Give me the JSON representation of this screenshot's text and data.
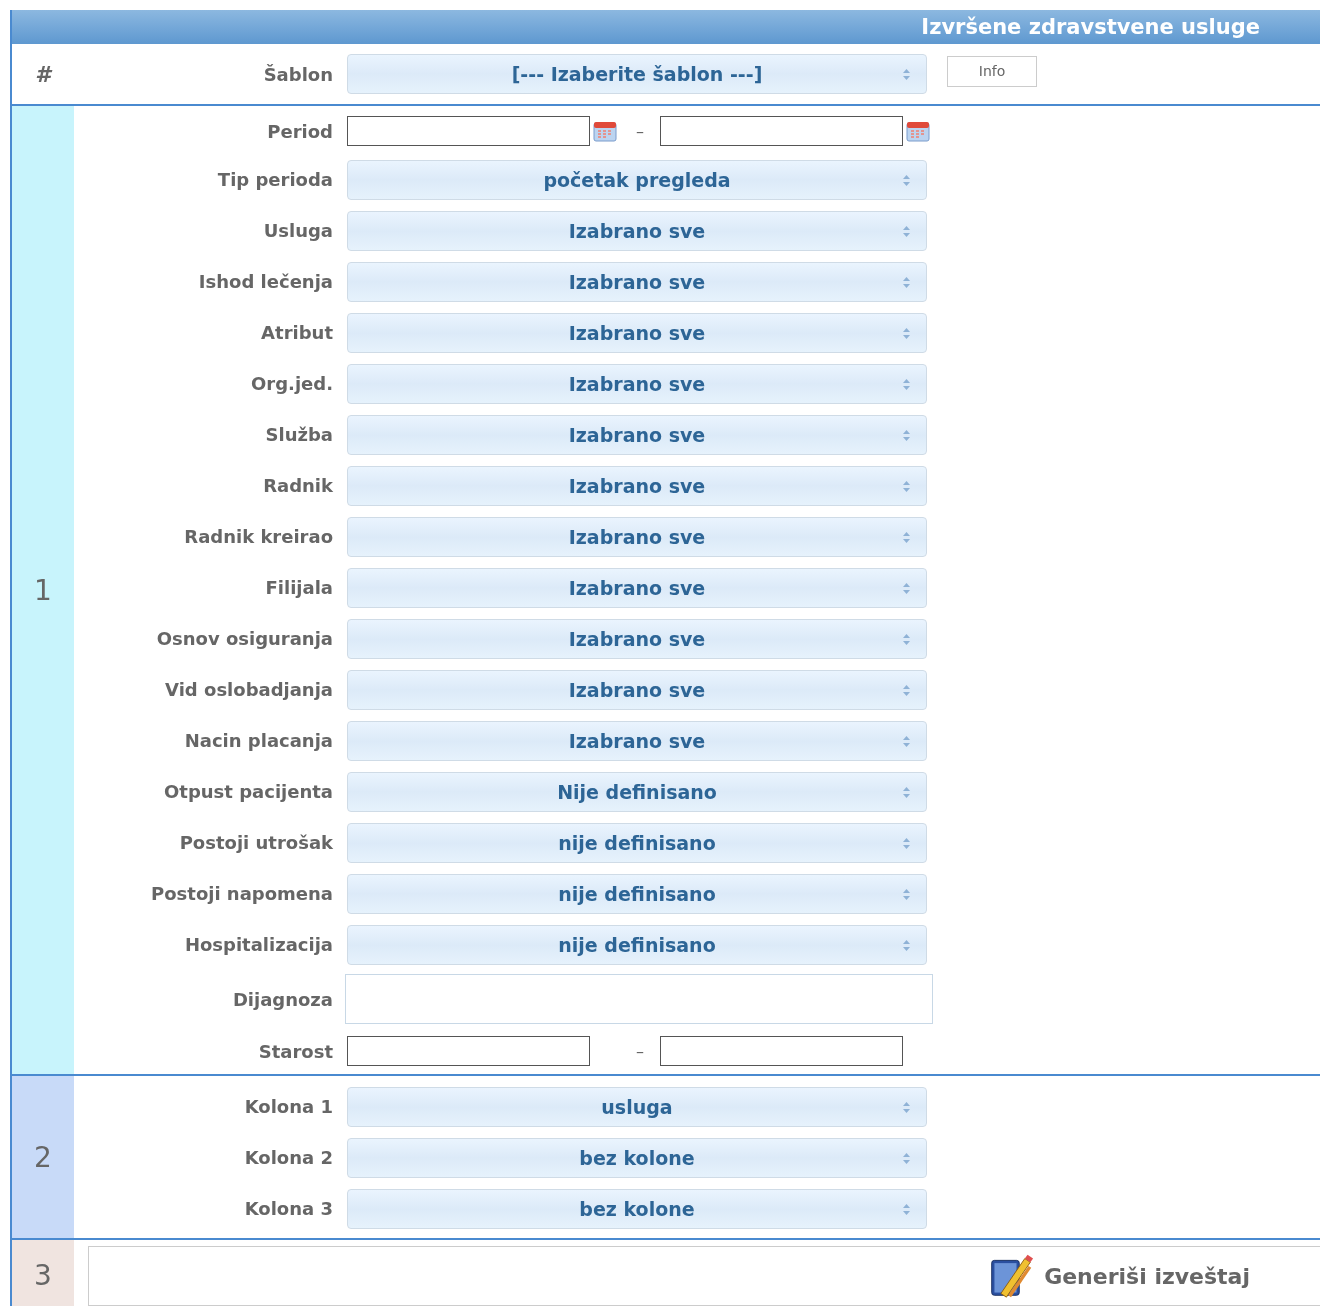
{
  "title": "Izvršene zdravstvene usluge",
  "header": {
    "symbol": "#",
    "label": "Šablon",
    "value": "[--- Izaberite šablon ---]",
    "info_button": "Info"
  },
  "sections": [
    {
      "number": "1",
      "color": "#c8f4fc",
      "rows": [
        {
          "kind": "daterange",
          "label": "Period",
          "separator": "–"
        },
        {
          "kind": "select",
          "label": "Tip perioda",
          "value": "početak pregleda"
        },
        {
          "kind": "select",
          "label": "Usluga",
          "value": "Izabrano sve"
        },
        {
          "kind": "select",
          "label": "Ishod lečenja",
          "value": "Izabrano sve"
        },
        {
          "kind": "select",
          "label": "Atribut",
          "value": "Izabrano sve"
        },
        {
          "kind": "select",
          "label": "Org.jed.",
          "value": "Izabrano sve"
        },
        {
          "kind": "select",
          "label": "Služba",
          "value": "Izabrano sve"
        },
        {
          "kind": "select",
          "label": "Radnik",
          "value": "Izabrano sve"
        },
        {
          "kind": "select",
          "label": "Radnik kreirao",
          "value": "Izabrano sve"
        },
        {
          "kind": "select",
          "label": "Filijala",
          "value": "Izabrano sve"
        },
        {
          "kind": "select",
          "label": "Osnov osiguranja",
          "value": "Izabrano sve"
        },
        {
          "kind": "select",
          "label": "Vid oslobadjanja",
          "value": "Izabrano sve"
        },
        {
          "kind": "select",
          "label": "Nacin placanja",
          "value": "Izabrano sve"
        },
        {
          "kind": "select",
          "label": "Otpust pacijenta",
          "value": "Nije definisano"
        },
        {
          "kind": "select",
          "label": "Postoji utrošak",
          "value": "nije definisano"
        },
        {
          "kind": "select",
          "label": "Postoji napomena",
          "value": "nije definisano"
        },
        {
          "kind": "select",
          "label": "Hospitalizacija",
          "value": "nije definisano"
        },
        {
          "kind": "text",
          "label": "Dijagnoza"
        },
        {
          "kind": "range",
          "label": "Starost",
          "separator": "–"
        }
      ]
    },
    {
      "number": "2",
      "color": "#c8daf8",
      "rows": [
        {
          "kind": "select",
          "label": "Kolona 1",
          "value": "usluga"
        },
        {
          "kind": "select",
          "label": "Kolona 2",
          "value": "bez kolone"
        },
        {
          "kind": "select",
          "label": "Kolona 3",
          "value": "bez kolone"
        }
      ]
    }
  ],
  "footer": {
    "number": "3",
    "color": "#f0e4e0",
    "button": "Generiši izveštaj"
  }
}
